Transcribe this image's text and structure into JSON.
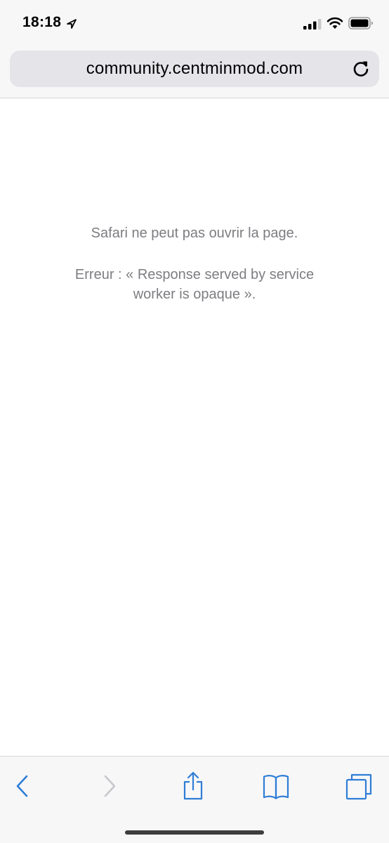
{
  "status_bar": {
    "time": "18:18"
  },
  "address_bar": {
    "url": "community.centminmod.com"
  },
  "page": {
    "error_title": "Safari ne peut pas ouvrir la page.",
    "error_detail": "Erreur : « Response served by service worker is opaque »."
  },
  "toolbar": {
    "items": [
      "back",
      "forward",
      "share",
      "bookmarks",
      "tabs"
    ]
  },
  "colors": {
    "accent": "#2f7dd6",
    "disabled": "#c7c7cc",
    "error_text": "#7d7d82",
    "chrome_bg": "#f7f7f8",
    "url_field_bg": "#e4e4e9"
  }
}
